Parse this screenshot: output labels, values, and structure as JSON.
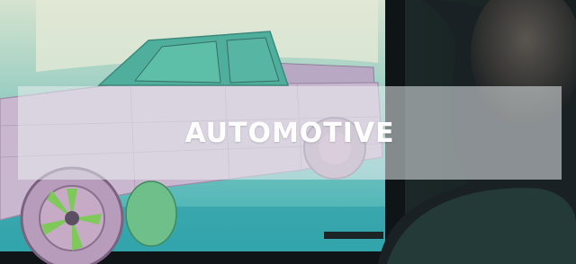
{
  "banner": {
    "title": "AUTOMOTIVE"
  },
  "scene": {
    "subject": "pickup-truck-3d-model-on-monitor",
    "colors": {
      "monitor_bg": "#3fb2b6",
      "truck_cab": "#4fae9c",
      "truck_body": "#c8b7cf",
      "wheel": "#b59db8",
      "rim_accent": "#7ec95a",
      "room_dark": "#1e2a2e",
      "banner_overlay": "#e8ecee"
    }
  }
}
